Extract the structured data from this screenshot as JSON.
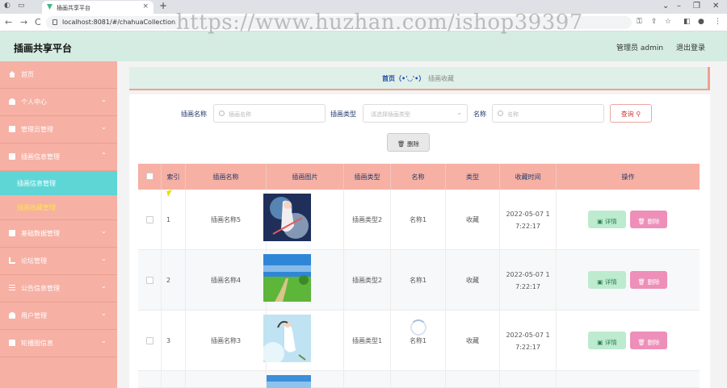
{
  "browser": {
    "tab_title": "插画共享平台",
    "url": "localhost:8081/#/chahuaCollection"
  },
  "watermark": "https://www.huzhan.com/ishop39397",
  "header": {
    "brand": "插画共享平台",
    "user": "管理员 admin",
    "logout": "退出登录"
  },
  "sidebar": {
    "items": [
      {
        "label": "首页",
        "icon": "home-icon"
      },
      {
        "label": "个人中心",
        "icon": "user-icon"
      },
      {
        "label": "管理员管理",
        "icon": "admin-icon"
      },
      {
        "label": "插画信息管理",
        "icon": "gift-icon"
      },
      {
        "label": "插画信息管理"
      },
      {
        "label": "插画收藏管理"
      },
      {
        "label": "基础数据管理",
        "icon": "database-icon"
      },
      {
        "label": "论坛管理",
        "icon": "chart-icon"
      },
      {
        "label": "公告信息管理",
        "icon": "list-icon"
      },
      {
        "label": "用户管理",
        "icon": "users-icon"
      },
      {
        "label": "轮播图信息",
        "icon": "image-icon"
      }
    ]
  },
  "breadcrumb": {
    "home": "首页（•'◡'•）",
    "current": "插画收藏"
  },
  "filters": {
    "name_label": "插画名称",
    "name_placeholder": "插画名称",
    "type_label": "插画类型",
    "type_placeholder": "请选择插画类型",
    "title_label": "名称",
    "title_placeholder": "名称",
    "search_button": "查询",
    "delete_button": "删除"
  },
  "table": {
    "headers": [
      "索引",
      "插画名称",
      "插画图片",
      "插画类型",
      "名称",
      "类型",
      "收藏时间",
      "操作"
    ],
    "rows": [
      {
        "index": "1",
        "name": "插画名称5",
        "type": "插画类型2",
        "title": "名称1",
        "kind": "收藏",
        "time_line1": "2022-05-07 1",
        "time_line2": "7:22:17",
        "image": "anime-character"
      },
      {
        "index": "2",
        "name": "插画名称4",
        "type": "插画类型2",
        "title": "名称1",
        "kind": "收藏",
        "time_line1": "2022-05-07 1",
        "time_line2": "7:22:17",
        "image": "green-field-path"
      },
      {
        "index": "3",
        "name": "插画名称3",
        "type": "插画类型1",
        "title": "名称1",
        "kind": "收藏",
        "time_line1": "2022-05-07 1",
        "time_line2": "7:22:17",
        "image": "girl-in-sky"
      },
      {
        "index": "",
        "name": "",
        "type": "",
        "title": "",
        "kind": "",
        "time_line1": "",
        "time_line2": "",
        "image": "blue-sky"
      }
    ],
    "detail_button": "详情",
    "delete_button": "删除"
  },
  "colors": {
    "sidebar": "#f6b0a4",
    "header": "#d5ece3",
    "active_submenu": "#5fd6d6",
    "active_submenu_text": "#ffe44d",
    "table_header": "#f6b0a4",
    "detail_button": "#bdebcf",
    "delete_button": "#ee8fb9"
  }
}
